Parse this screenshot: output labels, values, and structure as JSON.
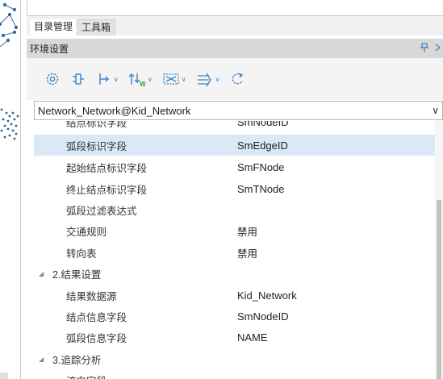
{
  "tabs": [
    {
      "label": "目录管理",
      "active": true
    },
    {
      "label": "工具箱",
      "active": false
    }
  ],
  "panel": {
    "title": "环境设置",
    "pin_glyph": "↑",
    "close_glyph": "×"
  },
  "toolbar": {
    "buttons": [
      {
        "icon": "settings-gear-icon",
        "dropdown": false
      },
      {
        "icon": "network-node-icon",
        "dropdown": false
      },
      {
        "icon": "trace-path-icon",
        "dropdown": true
      },
      {
        "icon": "weight-field-icon",
        "dropdown": true
      },
      {
        "icon": "barrier-icon",
        "dropdown": true
      },
      {
        "icon": "flow-direction-icon",
        "dropdown": true
      },
      {
        "icon": "refresh-icon",
        "dropdown": false
      }
    ]
  },
  "dataset": {
    "value": "Network_Network@Kid_Network",
    "chevron": "∨"
  },
  "grid": {
    "rows": [
      {
        "type": "prop",
        "label": "结点标识字段",
        "value": "SmNodeID",
        "clipped": true
      },
      {
        "type": "prop",
        "label": "弧段标识字段",
        "value": "SmEdgeID",
        "selected": true
      },
      {
        "type": "prop",
        "label": "起始结点标识字段",
        "value": "SmFNode"
      },
      {
        "type": "prop",
        "label": "终止结点标识字段",
        "value": "SmTNode"
      },
      {
        "type": "prop",
        "label": "弧段过滤表达式",
        "value": ""
      },
      {
        "type": "prop",
        "label": "交通规则",
        "value": "禁用"
      },
      {
        "type": "prop",
        "label": "转向表",
        "value": "禁用"
      },
      {
        "type": "cat",
        "label": "2.结果设置"
      },
      {
        "type": "prop",
        "label": "结果数据源",
        "value": "Kid_Network"
      },
      {
        "type": "prop",
        "label": "结点信息字段",
        "value": "SmNodeID"
      },
      {
        "type": "prop",
        "label": "弧段信息字段",
        "value": "NAME"
      },
      {
        "type": "cat",
        "label": "3.追踪分析"
      },
      {
        "type": "prop",
        "label": "流向字段",
        "value": ""
      }
    ]
  },
  "colors": {
    "accent": "#3b82c4",
    "selected_row": "#dbe9f7",
    "panel_header": "#d8d8d8"
  }
}
